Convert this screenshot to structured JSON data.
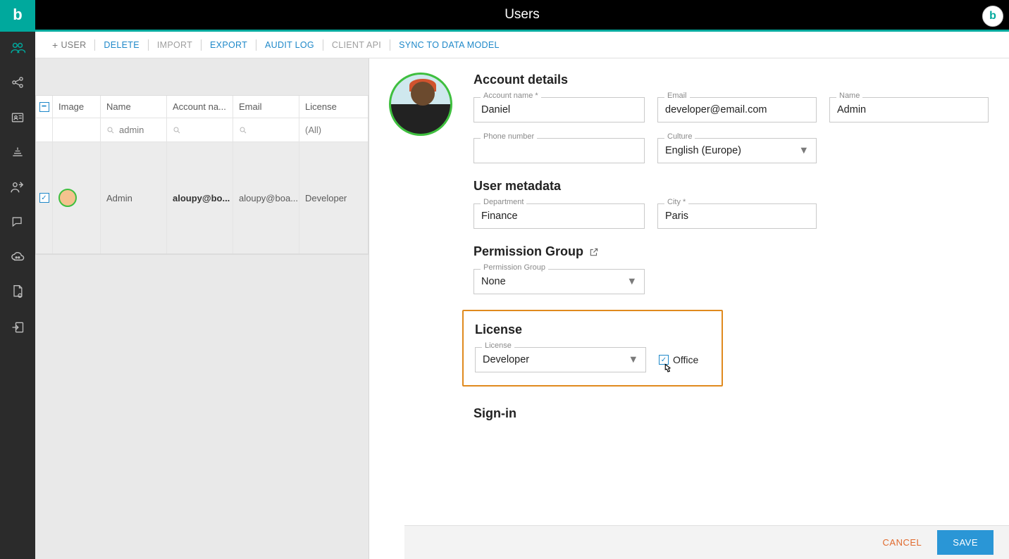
{
  "header": {
    "title": "Users"
  },
  "toolbar": {
    "add_user": "USER",
    "delete": "DELETE",
    "import": "IMPORT",
    "export": "EXPORT",
    "audit_log": "AUDIT LOG",
    "client_api": "CLIENT API",
    "sync": "SYNC TO DATA MODEL"
  },
  "table": {
    "headers": {
      "image": "Image",
      "name": "Name",
      "account": "Account na...",
      "email": "Email",
      "license": "License"
    },
    "filter": {
      "name": "admin",
      "license": "(All)"
    },
    "rows": [
      {
        "name": "Admin",
        "account": "aloupy@bo...",
        "email": "aloupy@boa...",
        "license": "Developer"
      }
    ]
  },
  "detail": {
    "sections": {
      "account": "Account details",
      "metadata": "User metadata",
      "permission": "Permission Group",
      "license": "License",
      "signin": "Sign-in"
    },
    "account": {
      "account_name_label": "Account name *",
      "account_name": "Daniel",
      "email_label": "Email",
      "email": "developer@email.com",
      "name_label": "Name",
      "name": "Admin",
      "phone_label": "Phone number",
      "phone": "",
      "culture_label": "Culture",
      "culture": "English (Europe)"
    },
    "metadata": {
      "department_label": "Department",
      "department": "Finance",
      "city_label": "City *",
      "city": "Paris"
    },
    "permission": {
      "group_label": "Permission Group",
      "group": "None"
    },
    "license": {
      "license_label": "License",
      "license": "Developer",
      "office_label": "Office"
    }
  },
  "footer": {
    "cancel": "CANCEL",
    "save": "SAVE"
  }
}
